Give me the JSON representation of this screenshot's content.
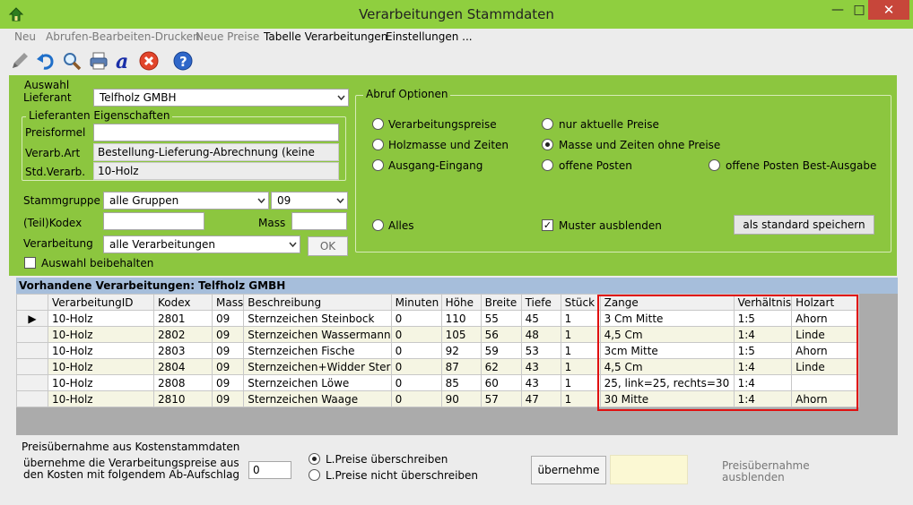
{
  "window": {
    "title": "Verarbeitungen Stammdaten"
  },
  "menu": {
    "items": [
      {
        "label": "Neu",
        "enabled": false
      },
      {
        "label": "Abrufen-Bearbeiten-Drucken",
        "enabled": false
      },
      {
        "label": "Neue Preise",
        "enabled": false
      },
      {
        "label": "Tabelle Verarbeitungen",
        "enabled": true
      },
      {
        "label": "Einstellungen ...",
        "enabled": true
      }
    ]
  },
  "toolbar": {
    "icons": [
      "pencil-icon",
      "undo-icon",
      "search-icon",
      "print-icon",
      "font-icon",
      "cancel-icon",
      "help-icon"
    ]
  },
  "auswahl": {
    "title": "Auswahl",
    "lieferant_label": "Lieferant",
    "lieferant_value": "Telfholz GMBH",
    "eigenschaften": {
      "title": "Lieferanten Eigenschaften",
      "preisformel_label": "Preisformel",
      "preisformel_value": "",
      "verarb_art_label": "Verarb.Art",
      "verarb_art_value": "Bestellung-Lieferung-Abrechnung (keine",
      "std_verarb_label": "Std.Verarb.",
      "std_verarb_value": "10-Holz"
    },
    "stammgruppe_label": "Stammgruppe",
    "stammgruppe_value": "alle Gruppen",
    "stammgruppe_code": "09",
    "teilkodex_label": "(Teil)Kodex",
    "teilkodex_value": "",
    "mass_label": "Mass",
    "mass_value": "",
    "verarbeitung_label": "Verarbeitung",
    "verarbeitung_value": "alle Verarbeitungen",
    "ok_label": "OK",
    "beibehalten_label": "Auswahl beibehalten",
    "beibehalten_checked": false
  },
  "abruf": {
    "title": "Abruf Optionen",
    "options": {
      "verarbeitungspreise": "Verarbeitungspreise",
      "holzmasse": "Holzmasse und Zeiten",
      "ausgang": "Ausgang-Eingang",
      "nur_aktuelle": "nur aktuelle Preise",
      "masse_ohne_preise": "Masse und Zeiten ohne Preise",
      "offene_posten": "offene Posten",
      "offene_posten_best": "offene Posten Best-Ausgabe",
      "alles": "Alles"
    },
    "selected": "masse_ohne_preise",
    "muster_label": "Muster ausblenden",
    "muster_checked": true,
    "standard_button": "als standard speichern"
  },
  "grid": {
    "title": "Vorhandene Verarbeitungen: Telfholz GMBH",
    "columns": [
      "VerarbeitungID",
      "Kodex",
      "Mass",
      "Beschreibung",
      "Minuten",
      "Höhe",
      "Breite",
      "Tiefe",
      "Stück",
      "Zange",
      "Verhältnis",
      "Holzart"
    ],
    "rows": [
      [
        "10-Holz",
        "2801",
        "09",
        "Sternzeichen Steinbock",
        "0",
        "110",
        "55",
        "45",
        "1",
        "3 Cm Mitte",
        "1:5",
        "Ahorn"
      ],
      [
        "10-Holz",
        "2802",
        "09",
        "Sternzeichen Wassermann",
        "0",
        "105",
        "56",
        "48",
        "1",
        "4,5 Cm",
        "1:4",
        "Linde"
      ],
      [
        "10-Holz",
        "2803",
        "09",
        "Sternzeichen Fische",
        "0",
        "92",
        "59",
        "53",
        "1",
        "3cm Mitte",
        "1:5",
        "Ahorn"
      ],
      [
        "10-Holz",
        "2804",
        "09",
        "Sternzeichen+Widder Ster",
        "0",
        "87",
        "62",
        "43",
        "1",
        "4,5 Cm",
        "1:4",
        "Linde"
      ],
      [
        "10-Holz",
        "2808",
        "09",
        "Sternzeichen Löwe",
        "0",
        "85",
        "60",
        "43",
        "1",
        "25, link=25, rechts=30",
        "1:4",
        ""
      ],
      [
        "10-Holz",
        "2810",
        "09",
        "Sternzeichen Waage",
        "0",
        "90",
        "57",
        "47",
        "1",
        "30 Mitte",
        "1:4",
        "Ahorn"
      ]
    ],
    "current_row": 0
  },
  "preisuebernahme": {
    "heading": "Preisübernahme aus Kostenstammdaten",
    "desc_line1": "übernehme die Verarbeitungspreise aus",
    "desc_line2": "den Kosten mit folgendem Ab-Aufschlag",
    "aufschlag_value": "0",
    "radio_overwrite": "L.Preise überschreiben",
    "radio_no_overwrite": "L.Preise nicht überschreiben",
    "overwrite_selected": true,
    "button": "übernehme",
    "hide_line1": "Preisübernahme",
    "hide_line2": "ausblenden"
  }
}
